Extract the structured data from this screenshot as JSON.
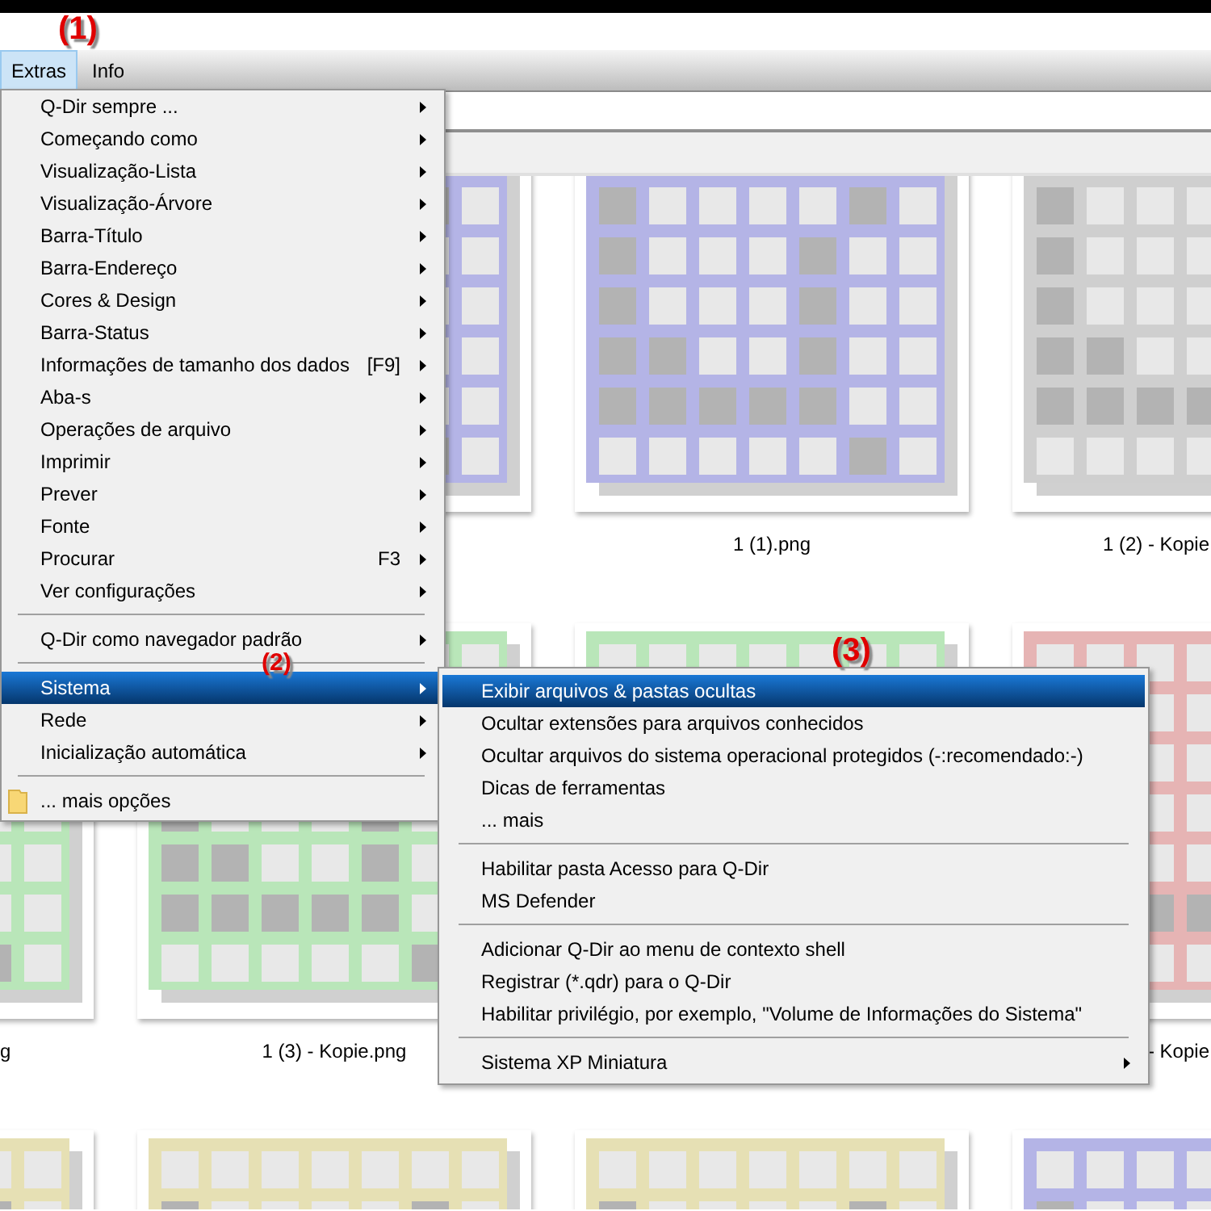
{
  "annotations": [
    {
      "label": "(1)"
    },
    {
      "label": "(2)"
    },
    {
      "label": "(3)"
    }
  ],
  "menubar": [
    {
      "label": "Extras",
      "selected": true
    },
    {
      "label": "Info",
      "selected": false
    }
  ],
  "main_menu": {
    "items": [
      {
        "kind": "item",
        "label": "Q-Dir sempre ...",
        "has_submenu": true,
        "selected": false
      },
      {
        "kind": "item",
        "label": "Começando como",
        "has_submenu": true,
        "selected": false
      },
      {
        "kind": "item",
        "label": "Visualização-Lista",
        "has_submenu": true,
        "selected": false
      },
      {
        "kind": "item",
        "label": "Visualização-Árvore",
        "has_submenu": true,
        "selected": false
      },
      {
        "kind": "item",
        "label": "Barra-Título",
        "has_submenu": true,
        "selected": false
      },
      {
        "kind": "item",
        "label": "Barra-Endereço",
        "has_submenu": true,
        "selected": false
      },
      {
        "kind": "item",
        "label": "Cores & Design",
        "has_submenu": true,
        "selected": false
      },
      {
        "kind": "item",
        "label": "Barra-Status",
        "has_submenu": true,
        "selected": false
      },
      {
        "kind": "item",
        "label": "Informações de tamanho dos dados",
        "shortcut": "[F9]",
        "has_submenu": true,
        "selected": false
      },
      {
        "kind": "item",
        "label": "Aba-s",
        "has_submenu": true,
        "selected": false
      },
      {
        "kind": "item",
        "label": "Operações de arquivo",
        "has_submenu": true,
        "selected": false
      },
      {
        "kind": "item",
        "label": "Imprimir",
        "has_submenu": true,
        "selected": false
      },
      {
        "kind": "item",
        "label": "Prever",
        "has_submenu": true,
        "selected": false
      },
      {
        "kind": "item",
        "label": "Fonte",
        "has_submenu": true,
        "selected": false
      },
      {
        "kind": "item",
        "label": "Procurar",
        "shortcut": "F3",
        "has_submenu": true,
        "selected": false
      },
      {
        "kind": "item",
        "label": "Ver configurações",
        "has_submenu": true,
        "selected": false
      },
      {
        "kind": "separator"
      },
      {
        "kind": "item",
        "label": "Q-Dir como navegador padrão",
        "has_submenu": true,
        "selected": false
      },
      {
        "kind": "separator"
      },
      {
        "kind": "item",
        "label": "Sistema",
        "has_submenu": true,
        "selected": true
      },
      {
        "kind": "item",
        "label": "Rede",
        "has_submenu": true,
        "selected": false
      },
      {
        "kind": "item",
        "label": "Inicialização automática",
        "has_submenu": true,
        "selected": false
      },
      {
        "kind": "separator"
      },
      {
        "kind": "folder",
        "label": "... mais opções",
        "has_submenu": false,
        "selected": false
      }
    ]
  },
  "sub_menu": {
    "items": [
      {
        "kind": "item",
        "label": "Exibir arquivos & pastas ocultas",
        "has_submenu": false,
        "selected": true
      },
      {
        "kind": "item",
        "label": "Ocultar extensões para arquivos conhecidos",
        "has_submenu": false,
        "selected": false
      },
      {
        "kind": "item",
        "label": "Ocultar arquivos do sistema operacional protegidos (-:recomendado:-)",
        "has_submenu": false,
        "selected": false
      },
      {
        "kind": "item",
        "label": "Dicas de ferramentas",
        "has_submenu": false,
        "selected": false
      },
      {
        "kind": "item",
        "label": "... mais",
        "has_submenu": false,
        "selected": false
      },
      {
        "kind": "separator"
      },
      {
        "kind": "item",
        "label": "Habilitar pasta Acesso para Q-Dir",
        "has_submenu": false,
        "selected": false
      },
      {
        "kind": "item",
        "label": "MS Defender",
        "has_submenu": false,
        "selected": false
      },
      {
        "kind": "separator"
      },
      {
        "kind": "item",
        "label": "Adicionar Q-Dir ao menu de contexto shell",
        "has_submenu": false,
        "selected": false
      },
      {
        "kind": "item",
        "label": "Registrar (*.qdr) para o Q-Dir",
        "has_submenu": false,
        "selected": false
      },
      {
        "kind": "item",
        "label": "Habilitar privilégio, por exemplo, \"Volume de Informações do Sistema\"",
        "has_submenu": false,
        "selected": false
      },
      {
        "kind": "separator"
      },
      {
        "kind": "item",
        "label": "Sistema XP Miniatura",
        "has_submenu": true,
        "selected": false
      }
    ]
  },
  "file_rows": [
    {
      "tiles": [
        {
          "color": "#b4b4e6"
        },
        {
          "color": "#b4b4e6",
          "label": "1 (1).png"
        },
        {
          "color": "#cfcfcf",
          "label": "1 (2) - Kopie"
        }
      ]
    },
    {
      "tiles": [
        {
          "color": "#b9e6b9",
          "label": "g"
        },
        {
          "color": "#b9e6b9",
          "label": "1 (3) - Kopie.png"
        },
        {
          "color": "#b9e6b9"
        },
        {
          "color": "#e6b4b4",
          "label": "- Kopie"
        }
      ]
    },
    {
      "tiles": [
        {
          "color": "#e6e0b4"
        },
        {
          "color": "#e6e0b4"
        },
        {
          "color": "#e6e0b4"
        },
        {
          "color": "#b4b4e6"
        }
      ]
    }
  ]
}
